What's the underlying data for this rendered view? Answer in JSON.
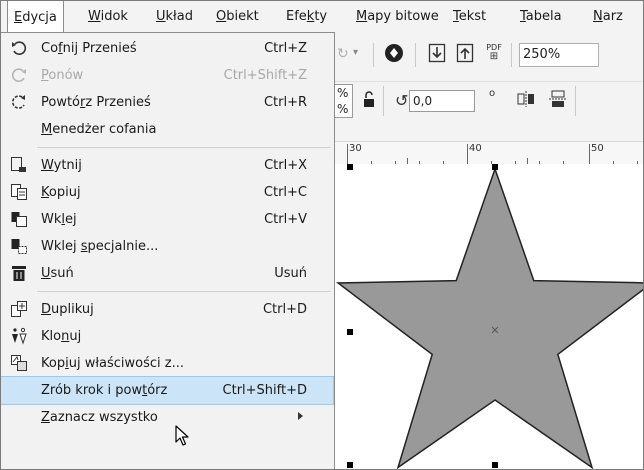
{
  "menubar": {
    "items": [
      {
        "label": "Edycja",
        "u": 0
      },
      {
        "label": "Widok",
        "u": 0
      },
      {
        "label": "Układ",
        "u": 0
      },
      {
        "label": "Obiekt",
        "u": 0
      },
      {
        "label": "Efekty",
        "u": 3
      },
      {
        "label": "Mapy bitowe",
        "u": 0
      },
      {
        "label": "Tekst",
        "u": 0
      },
      {
        "label": "Tabela",
        "u": 0
      },
      {
        "label": "Narz",
        "u": 0
      }
    ]
  },
  "dropdown": {
    "items": [
      {
        "label": "Cofnij Przenieś",
        "u": 2,
        "shortcut": "Ctrl+Z",
        "icon": "undo-icon",
        "disabled": false
      },
      {
        "label": "Ponów",
        "u": 0,
        "shortcut": "Ctrl+Shift+Z",
        "icon": "redo-icon",
        "disabled": true
      },
      {
        "label": "Powtórz Przenieś",
        "u": 5,
        "shortcut": "Ctrl+R",
        "icon": "repeat-icon",
        "disabled": false
      },
      {
        "label": "Menedżer cofania",
        "u": 0,
        "shortcut": "",
        "icon": "",
        "disabled": false
      },
      {
        "sep": true
      },
      {
        "label": "Wytnij",
        "u": 0,
        "shortcut": "Ctrl+X",
        "icon": "cut-icon",
        "disabled": false
      },
      {
        "label": "Kopiuj",
        "u": 0,
        "shortcut": "Ctrl+C",
        "icon": "copy-icon",
        "disabled": false
      },
      {
        "label": "Wklej",
        "u": 2,
        "shortcut": "Ctrl+V",
        "icon": "paste-icon",
        "disabled": false
      },
      {
        "label": "Wklej specjalnie...",
        "u": 6,
        "shortcut": "",
        "icon": "paste-special-icon",
        "disabled": false
      },
      {
        "label": "Usuń",
        "u": 0,
        "shortcut": "Usuń",
        "icon": "trash-icon",
        "disabled": false
      },
      {
        "sep": true
      },
      {
        "label": "Duplikuj",
        "u": 0,
        "shortcut": "Ctrl+D",
        "icon": "duplicate-icon",
        "disabled": false
      },
      {
        "label": "Klonuj",
        "u": 3,
        "shortcut": "",
        "icon": "clone-icon",
        "disabled": false
      },
      {
        "label": "Kopiuj właściwości z...",
        "u": 3,
        "shortcut": "",
        "icon": "copy-properties-icon",
        "disabled": false
      },
      {
        "label": "Zrób krok i powtórz",
        "u": 15,
        "shortcut": "Ctrl+Shift+D",
        "icon": "",
        "disabled": false,
        "highlight": true
      },
      {
        "label": "Zaznacz wszystko",
        "u": 0,
        "shortcut": "",
        "icon": "",
        "disabled": false,
        "submenu": true
      }
    ]
  },
  "toolbar": {
    "pdf_label": "PDF",
    "zoom": "250%",
    "percent_top": "%",
    "percent_bottom": "%",
    "rotation": "0,0",
    "degree_symbol": "o"
  },
  "ruler": {
    "labels": [
      "30",
      "40",
      "50"
    ]
  },
  "colors": {
    "star_fill": "#999999",
    "highlight": "#cce4f7",
    "menu_bg": "#f2f2f2"
  }
}
